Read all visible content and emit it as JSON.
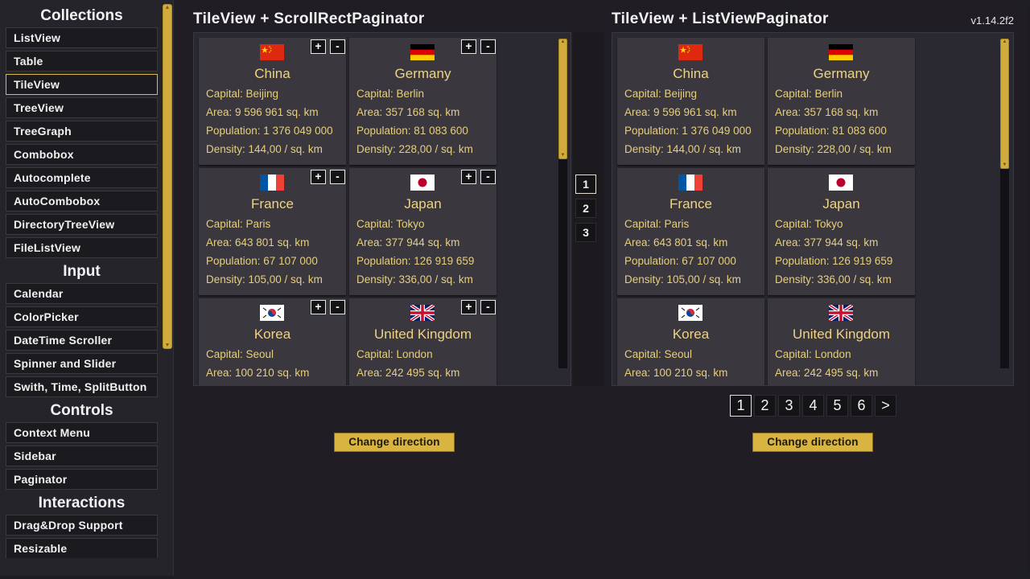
{
  "sidebar": {
    "sections": [
      {
        "title": "Collections",
        "items": [
          "ListView",
          "Table",
          "TileView",
          "TreeView",
          "TreeGraph",
          "Combobox",
          "Autocomplete",
          "AutoCombobox",
          "DirectoryTreeView",
          "FileListView"
        ]
      },
      {
        "title": "Input",
        "items": [
          "Calendar",
          "ColorPicker",
          "DateTime Scroller",
          "Spinner and Slider",
          "Swith, Time, SplitButton"
        ]
      },
      {
        "title": "Controls",
        "items": [
          "Context Menu",
          "Sidebar",
          "Paginator"
        ]
      },
      {
        "title": "Interactions",
        "items": [
          "Drag&Drop Support",
          "Resizable"
        ]
      }
    ],
    "active_item": "TileView"
  },
  "version": "v1.14.2f2",
  "left_panel": {
    "title": "TileView + ScrollRectPaginator",
    "pages": [
      "1",
      "2",
      "3"
    ],
    "active_page": "1",
    "change_label": "Change direction"
  },
  "right_panel": {
    "title": "TileView + ListViewPaginator",
    "pages": [
      "1",
      "2",
      "3",
      "4",
      "5",
      "6",
      ">"
    ],
    "active_page": "1",
    "change_label": "Change direction"
  },
  "tile_labels": {
    "capital": "Capital: ",
    "area": "Area: ",
    "population": "Population: ",
    "density": "Density: ",
    "plus": "+",
    "minus": "-"
  },
  "countries": [
    {
      "name": "China",
      "capital": "Beijing",
      "area": "9 596 961 sq. km",
      "population": "1 376 049 000",
      "density": "144,00 / sq. km",
      "flag": "china-flag-icon"
    },
    {
      "name": "Germany",
      "capital": "Berlin",
      "area": "357 168 sq. km",
      "population": "81 083 600",
      "density": "228,00 / sq. km",
      "flag": "germany-flag-icon"
    },
    {
      "name": "France",
      "capital": "Paris",
      "area": "643 801 sq. km",
      "population": "67 107 000",
      "density": "105,00 / sq. km",
      "flag": "france-flag-icon"
    },
    {
      "name": "Japan",
      "capital": "Tokyo",
      "area": "377 944 sq. km",
      "population": "126 919 659",
      "density": "336,00 / sq. km",
      "flag": "japan-flag-icon"
    },
    {
      "name": "Korea",
      "capital": "Seoul",
      "area": "100 210 sq. km",
      "population": "",
      "density": "",
      "flag": "korea-flag-icon"
    },
    {
      "name": "United Kingdom",
      "capital": "London",
      "area": "242 495 sq. km",
      "population": "",
      "density": "",
      "flag": "uk-flag-icon"
    }
  ],
  "colors": {
    "accent": "#d1ab3b",
    "tile_text": "#e6cf7d",
    "tile_bg": "#3a373e"
  }
}
